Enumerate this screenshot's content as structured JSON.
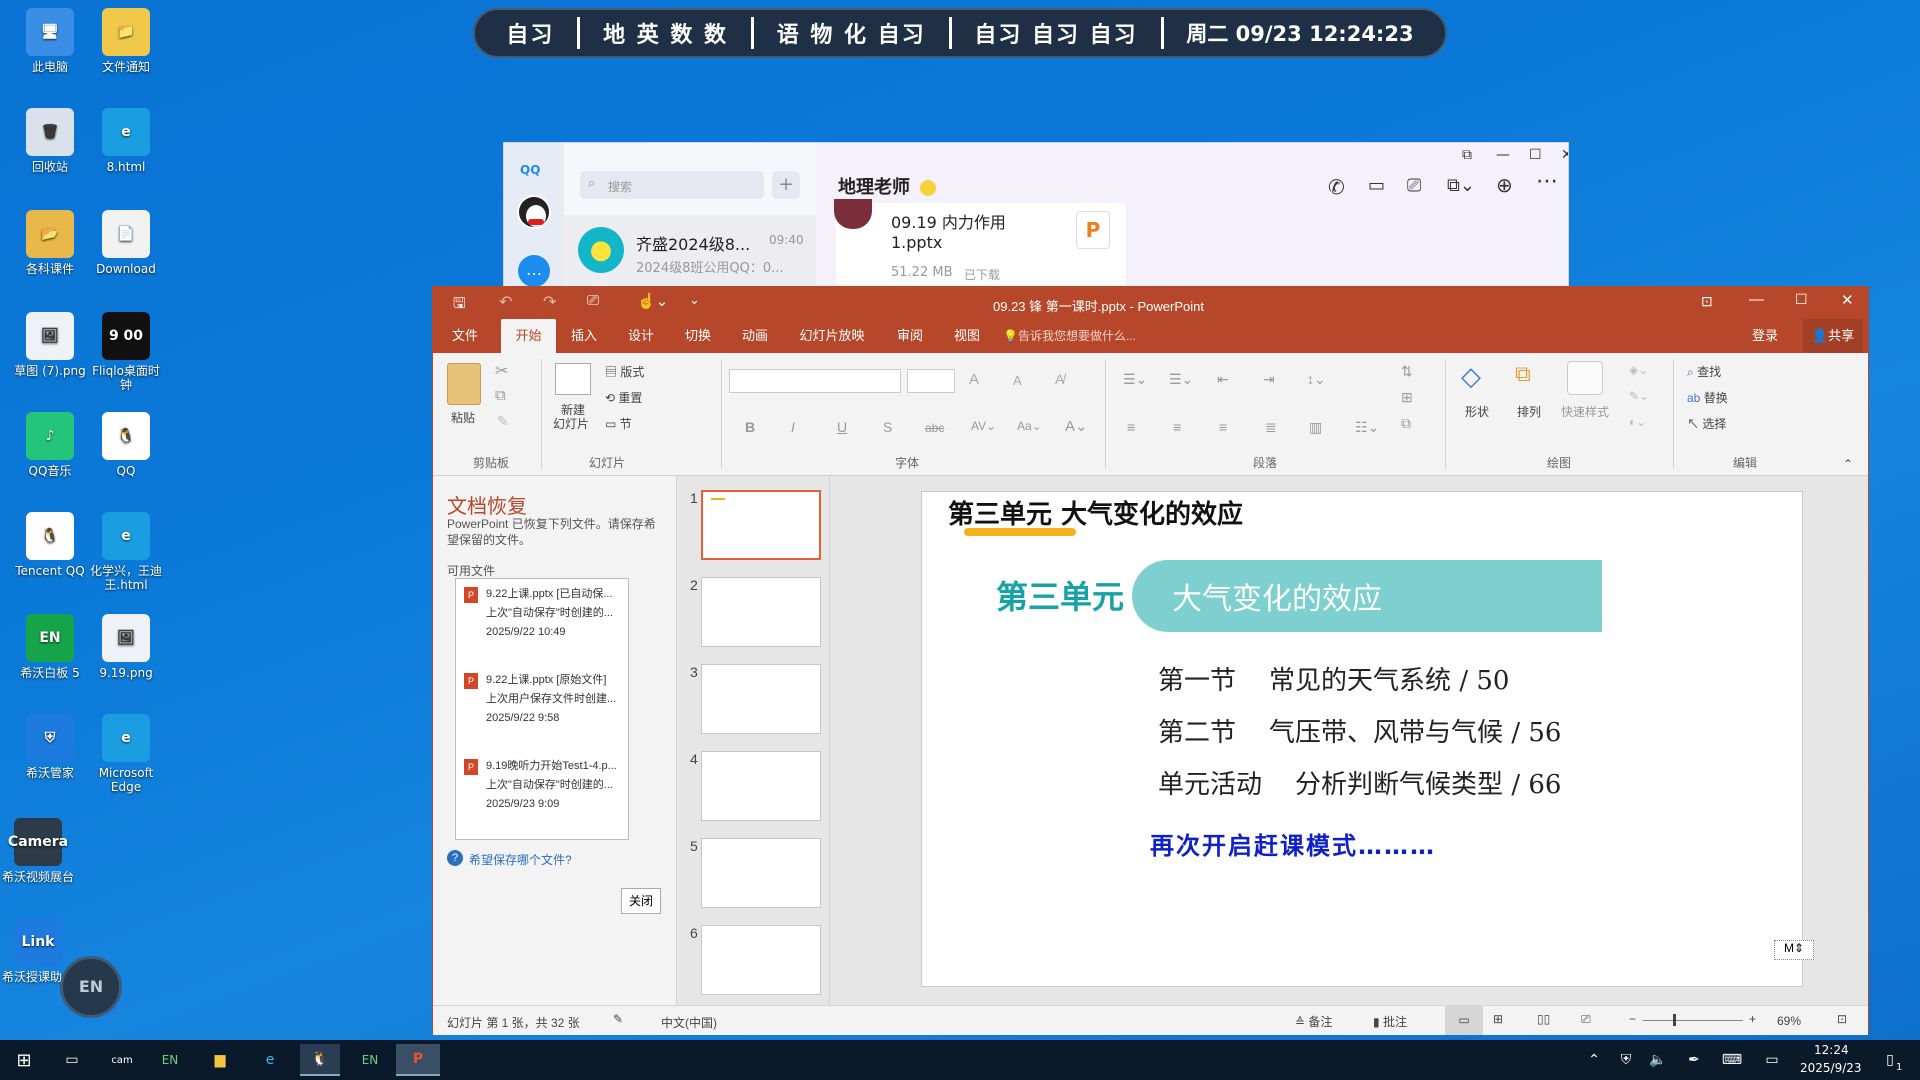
{
  "desktop_icons": [
    {
      "label": "此电脑",
      "glyph": "🖥"
    },
    {
      "label": "文件通知",
      "glyph": "📁"
    },
    {
      "label": "回收站",
      "glyph": "🗑"
    },
    {
      "label": "8.html",
      "glyph": "e"
    },
    {
      "label": "各科课件",
      "glyph": "📂"
    },
    {
      "label": "Download",
      "glyph": "📄"
    },
    {
      "label": "草图 (7).png",
      "glyph": "🖼"
    },
    {
      "label": "Fliqlo桌面时钟",
      "glyph": "9 00"
    },
    {
      "label": "QQ音乐",
      "glyph": "♪"
    },
    {
      "label": "QQ",
      "glyph": "🐧"
    },
    {
      "label": "Tencent QQ",
      "glyph": "🐧"
    },
    {
      "label": "化学兴，王迪王.html",
      "glyph": "e"
    },
    {
      "label": "希沃白板 5",
      "glyph": "EN"
    },
    {
      "label": "9.19.png",
      "glyph": "🖼"
    },
    {
      "label": "希沃管家",
      "glyph": "⛨"
    },
    {
      "label": "Microsoft Edge",
      "glyph": "e"
    },
    {
      "label": "希沃视频展台",
      "glyph": "Camera"
    },
    {
      "label": "希沃授课助手",
      "glyph": "Link"
    }
  ],
  "schedule_bar": {
    "g1": "自习",
    "g2": "地 英 数 数",
    "g3": "语 物 化 自习",
    "g4": "自习 自习 自习",
    "datetime": "周二 09/23  12:24:23"
  },
  "qq": {
    "logo": "QQ",
    "search_placeholder": "搜索",
    "plus": "+",
    "chat_name": "齐盛2024级8...",
    "chat_time": "09:40",
    "chat_preview": "2024级8班公用QQ：0...",
    "contact_title": "地理老师",
    "file_name_1": "09.19 内力作用",
    "file_name_2": "1.pptx",
    "file_size": "51.22 MB",
    "file_status": "已下载",
    "file_badge": "P"
  },
  "ppt": {
    "window_title": "09.23 锋 第一课时.pptx - PowerPoint",
    "tabs": [
      "文件",
      "开始",
      "插入",
      "设计",
      "切换",
      "动画",
      "幻灯片放映",
      "审阅",
      "视图"
    ],
    "tell_me": "告诉我您想要做什么...",
    "login": "登录",
    "share": "共享",
    "ribbon": {
      "paste": "粘贴",
      "clipboard": "剪贴板",
      "new_slide_1": "新建",
      "new_slide_2": "幻灯片",
      "layout": "版式",
      "reset": "重置",
      "section": "节",
      "slides_group": "幻灯片",
      "font_group": "字体",
      "paragraph_group": "段落",
      "shapes": "形状",
      "arrange": "排列",
      "quick_styles": "快速样式",
      "drawing_group": "绘图",
      "find": "查找",
      "replace": "替换",
      "select": "选择",
      "editing_group": "编辑"
    },
    "recovery": {
      "title": "文档恢复",
      "desc": "PowerPoint 已恢复下列文件。请保存希望保留的文件。",
      "available": "可用文件",
      "files": [
        {
          "name": "9.22上课.pptx  [已自动保...",
          "desc": "上次\"自动保存\"时创建的...",
          "date": "2025/9/22 10:49"
        },
        {
          "name": "9.22上课.pptx  [原始文件]",
          "desc": "上次用户保存文件时创建...",
          "date": "2025/9/22 9:58"
        },
        {
          "name": "9.19晚听力开始Test1-4.p...",
          "desc": "上次\"自动保存\"时创建的...",
          "date": "2025/9/23 9:09"
        }
      ],
      "help_link": "希望保存哪个文件?",
      "close": "关闭"
    },
    "thumb_numbers": [
      "1",
      "2",
      "3",
      "4",
      "5",
      "6"
    ],
    "slide": {
      "heading": "第三单元 大气变化的效应",
      "unit_label": "第三单元",
      "unit_title": "大气变化的效应",
      "lines": [
        "第一节    常见的天气系统 / 50",
        "第二节    气压带、风带与气候 / 56",
        "单元活动    分析判断气候类型 / 66"
      ],
      "note": "再次开启赶课模式………"
    },
    "status": {
      "slide_count": "幻灯片 第 1 张，共 32 张",
      "language": "中文(中国)",
      "notes": "备注",
      "comments": "批注",
      "zoom": "69%"
    }
  },
  "taskbar": {
    "time": "12:24",
    "date": "2025/9/23",
    "notif_count": "1"
  },
  "colors": {
    "ppt_red": "#b7472a",
    "slide_teal": "#7ecfcf",
    "slide_blue": "#1020c8",
    "slide_teal_text": "#17a2a6"
  }
}
